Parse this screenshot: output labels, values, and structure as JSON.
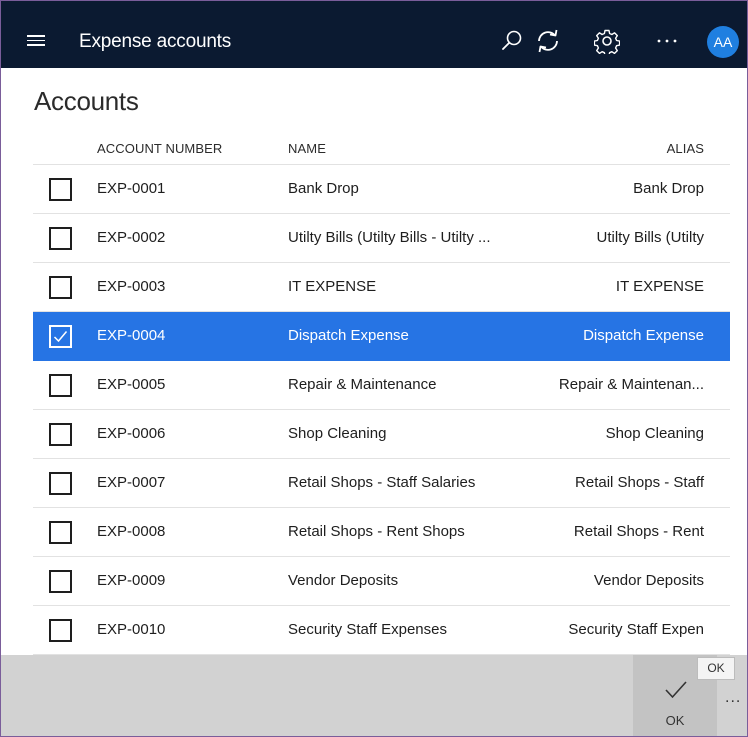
{
  "app": {
    "title": "Expense accounts",
    "avatar_initials": "AA",
    "accent_color": "#1f7fe0",
    "icons": [
      "menu-icon",
      "search-icon",
      "refresh-icon",
      "gear-icon",
      "more-icon"
    ]
  },
  "page": {
    "title": "Accounts"
  },
  "grid": {
    "columns": [
      "ACCOUNT NUMBER",
      "NAME",
      "ALIAS"
    ],
    "selected_row_color": "#2674e4",
    "rows": [
      {
        "number": "EXP-0001",
        "name": "Bank Drop",
        "alias": "Bank Drop",
        "selected": false
      },
      {
        "number": "EXP-0002",
        "name": "Utilty Bills (Utilty Bills - Utilty ...",
        "alias": "Utilty Bills (Utilty",
        "selected": false
      },
      {
        "number": "EXP-0003",
        "name": "IT EXPENSE",
        "alias": "IT EXPENSE",
        "selected": false
      },
      {
        "number": "EXP-0004",
        "name": "Dispatch Expense",
        "alias": "Dispatch Expense",
        "selected": true
      },
      {
        "number": "EXP-0005",
        "name": "Repair & Maintenance",
        "alias": "Repair & Maintenan...",
        "selected": false
      },
      {
        "number": "EXP-0006",
        "name": "Shop Cleaning",
        "alias": "Shop Cleaning",
        "selected": false
      },
      {
        "number": "EXP-0007",
        "name": "Retail Shops - Staff Salaries",
        "alias": "Retail Shops - Staff",
        "selected": false
      },
      {
        "number": "EXP-0008",
        "name": "Retail Shops - Rent Shops",
        "alias": "Retail Shops - Rent",
        "selected": false
      },
      {
        "number": "EXP-0009",
        "name": "Vendor Deposits",
        "alias": "Vendor Deposits",
        "selected": false
      },
      {
        "number": "EXP-0010",
        "name": "Security Staff Expenses",
        "alias": "Security Staff Expen",
        "selected": false
      }
    ]
  },
  "footer": {
    "ok_label": "OK",
    "ok_tooltip": "OK",
    "more_label": "..."
  }
}
